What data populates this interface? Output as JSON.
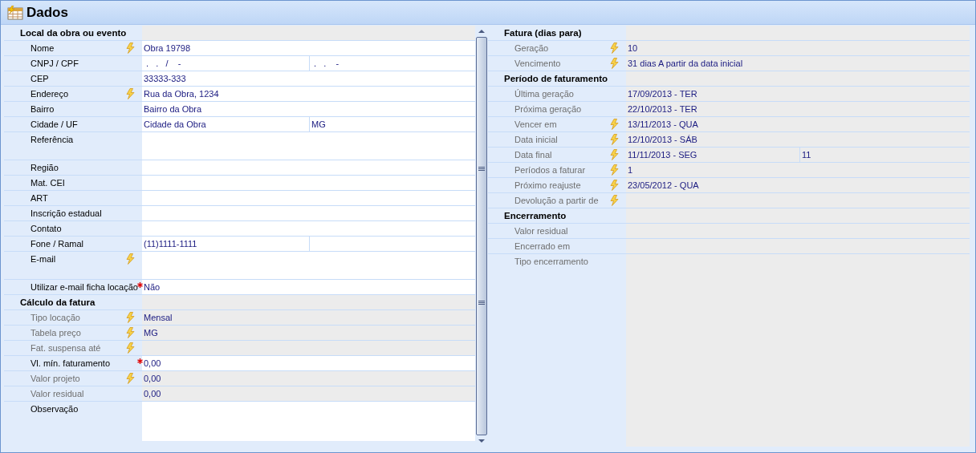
{
  "window": {
    "title": "Dados"
  },
  "panels": [
    {
      "scrollbar": true,
      "sections": [
        {
          "title": "Local da obra ou evento",
          "rows": [
            {
              "label": "Nome",
              "kind": "field",
              "lightning": true,
              "required": false,
              "disabled": false,
              "value": "Obra 19798"
            },
            {
              "label": "CNPJ / CPF",
              "kind": "split",
              "lightning": false,
              "required": false,
              "disabled": false,
              "value": " .   .   /    -",
              "value_2": " .   .    -"
            },
            {
              "label": "CEP",
              "kind": "field",
              "lightning": false,
              "required": false,
              "disabled": false,
              "value": "33333-333"
            },
            {
              "label": "Endereço",
              "kind": "field",
              "lightning": true,
              "required": false,
              "disabled": false,
              "value": "Rua da Obra, 1234"
            },
            {
              "label": "Bairro",
              "kind": "field",
              "lightning": false,
              "required": false,
              "disabled": false,
              "value": "Bairro da Obra"
            },
            {
              "label": "Cidade / UF",
              "kind": "split",
              "lightning": false,
              "required": false,
              "disabled": false,
              "value": "Cidade da Obra",
              "value_2": "MG"
            },
            {
              "label": "Referência",
              "kind": "memo",
              "lightning": false,
              "required": false,
              "disabled": false
            },
            {
              "label": "Região",
              "kind": "field",
              "lightning": false,
              "required": false,
              "disabled": false
            },
            {
              "label": "Mat. CEI",
              "kind": "field",
              "lightning": false,
              "required": false,
              "disabled": false
            },
            {
              "label": "ART",
              "kind": "field",
              "lightning": false,
              "required": false,
              "disabled": false
            },
            {
              "label": "Inscrição estadual",
              "kind": "field",
              "lightning": false,
              "required": false,
              "disabled": false
            },
            {
              "label": "Contato",
              "kind": "field",
              "lightning": false,
              "required": false,
              "disabled": false
            },
            {
              "label": "Fone / Ramal",
              "kind": "split",
              "lightning": false,
              "required": false,
              "disabled": false,
              "value": "(11)1111-1111"
            },
            {
              "label": "E-mail",
              "kind": "memo",
              "lightning": true,
              "required": false,
              "disabled": false
            },
            {
              "label": "Utilizar e-mail ficha locação",
              "kind": "field",
              "lightning": false,
              "required": true,
              "disabled": false,
              "value": "Não"
            }
          ]
        },
        {
          "title": "Cálculo da fatura",
          "rows": [
            {
              "label": "Tipo locação",
              "kind": "field",
              "lightning": true,
              "required": false,
              "disabled": true,
              "value": "Mensal"
            },
            {
              "label": "Tabela preço",
              "kind": "field",
              "lightning": true,
              "required": false,
              "disabled": true,
              "value": "MG"
            },
            {
              "label": "Fat. suspensa até",
              "kind": "field",
              "lightning": true,
              "required": false,
              "disabled": true
            },
            {
              "label": "Vl. mín. faturamento",
              "kind": "field",
              "lightning": false,
              "required": true,
              "disabled": false,
              "value": "0,00"
            },
            {
              "label": "Valor projeto",
              "kind": "field",
              "lightning": true,
              "required": false,
              "disabled": true,
              "value": "0,00"
            },
            {
              "label": "Valor residual",
              "kind": "field",
              "lightning": false,
              "required": false,
              "disabled": true,
              "value": "0,00"
            },
            {
              "label": "Observação",
              "kind": "memo",
              "lightning": false,
              "required": false,
              "disabled": false
            }
          ]
        }
      ]
    },
    {
      "scrollbar": false,
      "sections": [
        {
          "title": "Fatura (dias para)",
          "rows": [
            {
              "label": "Geração",
              "kind": "field",
              "lightning": true,
              "required": false,
              "disabled": true,
              "value": "10"
            },
            {
              "label": "Vencimento",
              "kind": "field",
              "lightning": true,
              "required": false,
              "disabled": true,
              "value": "31 dias A partir da data inicial"
            }
          ]
        },
        {
          "title": "Período de faturamento",
          "rows": [
            {
              "label": "Última geração",
              "kind": "field",
              "lightning": false,
              "required": false,
              "disabled": true,
              "value": "17/09/2013 - TER"
            },
            {
              "label": "Próxima geração",
              "kind": "field",
              "lightning": false,
              "required": false,
              "disabled": true,
              "value": "22/10/2013 - TER"
            },
            {
              "label": "Vencer em",
              "kind": "field",
              "lightning": true,
              "required": false,
              "disabled": true,
              "value": "13/11/2013 - QUA"
            },
            {
              "label": "Data inicial",
              "kind": "field",
              "lightning": true,
              "required": false,
              "disabled": true,
              "value": "12/10/2013 - SÁB"
            },
            {
              "label": "Data final",
              "kind": "split",
              "lightning": true,
              "required": false,
              "disabled": true,
              "value": "11/11/2013 - SEG",
              "value_2": "11"
            },
            {
              "label": "Períodos a faturar",
              "kind": "field",
              "lightning": true,
              "required": false,
              "disabled": true,
              "value": "1"
            },
            {
              "label": "Próximo reajuste",
              "kind": "field",
              "lightning": true,
              "required": false,
              "disabled": true,
              "value": "23/05/2012 - QUA"
            },
            {
              "label": "Devolução a partir de",
              "kind": "field",
              "lightning": true,
              "required": false,
              "disabled": true
            }
          ]
        },
        {
          "title": "Encerramento",
          "rows": [
            {
              "label": "Valor residual",
              "kind": "field",
              "lightning": false,
              "required": false,
              "disabled": true
            },
            {
              "label": "Encerrado em",
              "kind": "field",
              "lightning": false,
              "required": false,
              "disabled": true
            },
            {
              "label": "Tipo encerramento",
              "kind": "field",
              "lightning": false,
              "required": false,
              "disabled": true
            }
          ]
        }
      ]
    }
  ]
}
